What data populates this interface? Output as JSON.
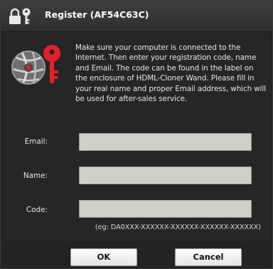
{
  "window": {
    "title": "Register (AF54C63C)",
    "title_icon": "lock-key-icon"
  },
  "message": {
    "icon": "key-globe-icon",
    "text": "Make sure your computer is connected to the Internet. Then enter your registration code, name and Email. The code can be found in the label on the enclosure of HDML-Cloner Wand. Please fill in your real name and proper Email address, which will be used for after-sales service."
  },
  "form": {
    "email_label": "Email:",
    "email_value": "",
    "name_label": "Name:",
    "name_value": "",
    "code_label": "Code:",
    "code_value": "",
    "code_hint": "(eg: DA0XXX-XXXXXX-XXXXXX-XXXXXX-XXXXXX)"
  },
  "buttons": {
    "ok_label": "OK",
    "cancel_label": "Cancel"
  },
  "colors": {
    "background": "#232323",
    "titlebar": "#363636",
    "input_fill": "#d0cfcb",
    "key_red": "#e2202a",
    "text": "#e6e6e6"
  }
}
